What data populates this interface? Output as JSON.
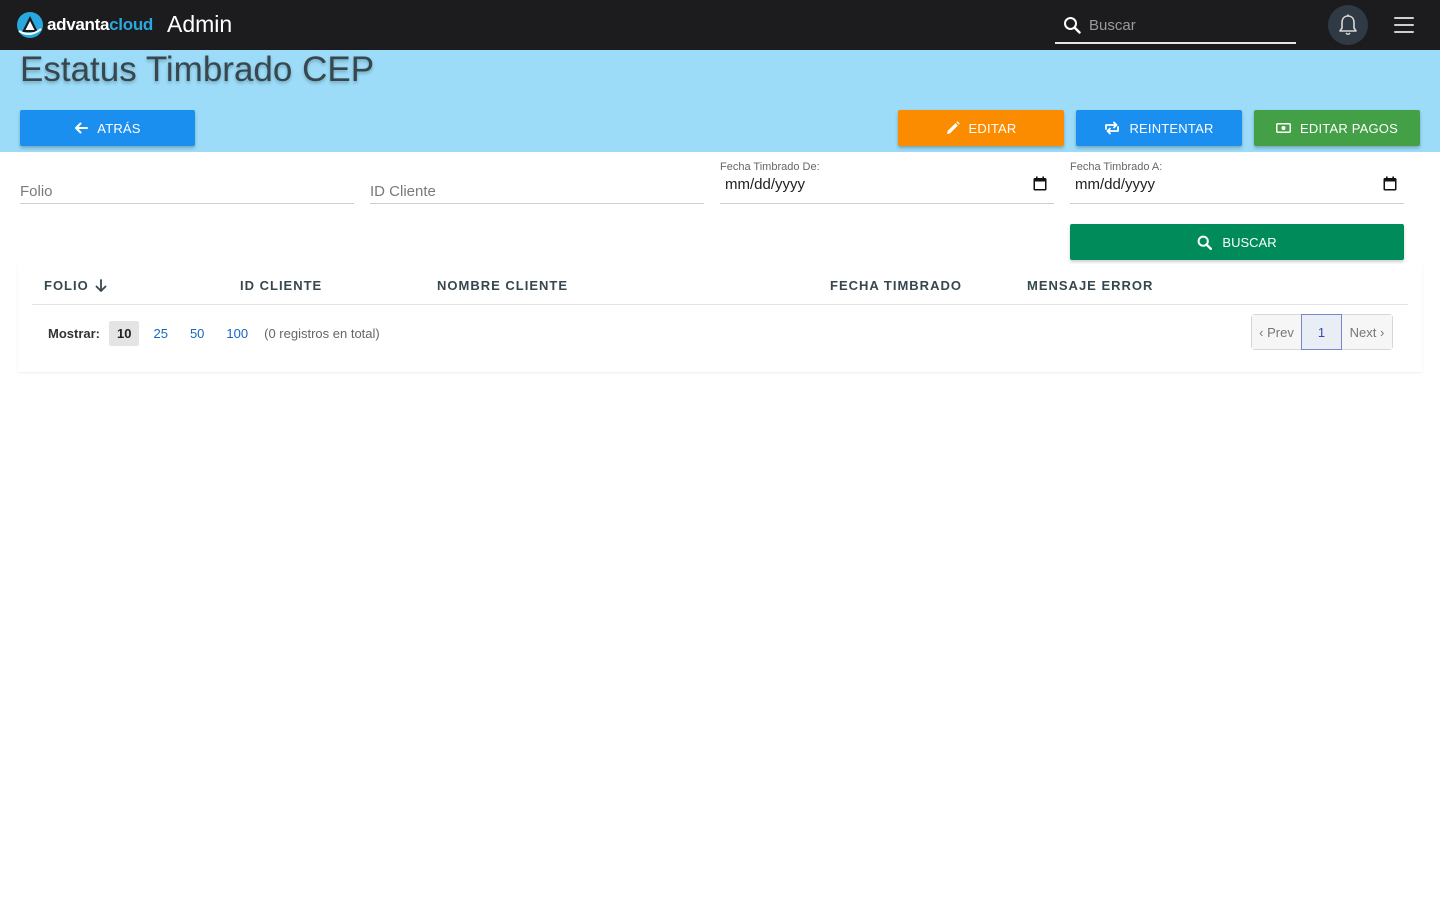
{
  "topbar": {
    "logo_part1": "advanta",
    "logo_part2": "cloud",
    "app_title": "Admin",
    "search_placeholder": "Buscar",
    "icons": [
      "logo-icon",
      "search-icon",
      "bell-icon",
      "hamburger-menu-icon"
    ]
  },
  "header": {
    "title": "Estatus Timbrado CEP",
    "buttons": {
      "back": "ATRÁS",
      "edit": "EDITAR",
      "retry": "REINTENTAR",
      "edit_payments": "EDITAR PAGOS"
    }
  },
  "filters": {
    "folio_placeholder": "Folio",
    "id_cliente_placeholder": "ID Cliente",
    "fecha_de_label": "Fecha Timbrado De:",
    "fecha_de_value": "mm/dd/yyyy",
    "fecha_a_label": "Fecha Timbrado A:",
    "fecha_a_value": "mm/dd/yyyy",
    "search_button": "BUSCAR"
  },
  "table": {
    "columns": [
      "FOLIO",
      "ID CLIENTE",
      "NOMBRE CLIENTE",
      "FECHA TIMBRADO",
      "MENSAJE ERROR"
    ],
    "rows": []
  },
  "pagination": {
    "show_label": "Mostrar:",
    "page_sizes": [
      "10",
      "25",
      "50",
      "100"
    ],
    "selected_page_size": "10",
    "total_text": "(0 registros en total)",
    "prev": "‹ Prev",
    "current_page": "1",
    "next": "Next ›"
  },
  "colors": {
    "topbar": "#1c1c1e",
    "header_band": "#9cdcf8",
    "primary_blue": "#1a8ff0",
    "edit_orange": "#fb8c00",
    "payments_green": "#43a047",
    "search_green": "#008c5a",
    "brand_cloud": "#29a8e0"
  }
}
